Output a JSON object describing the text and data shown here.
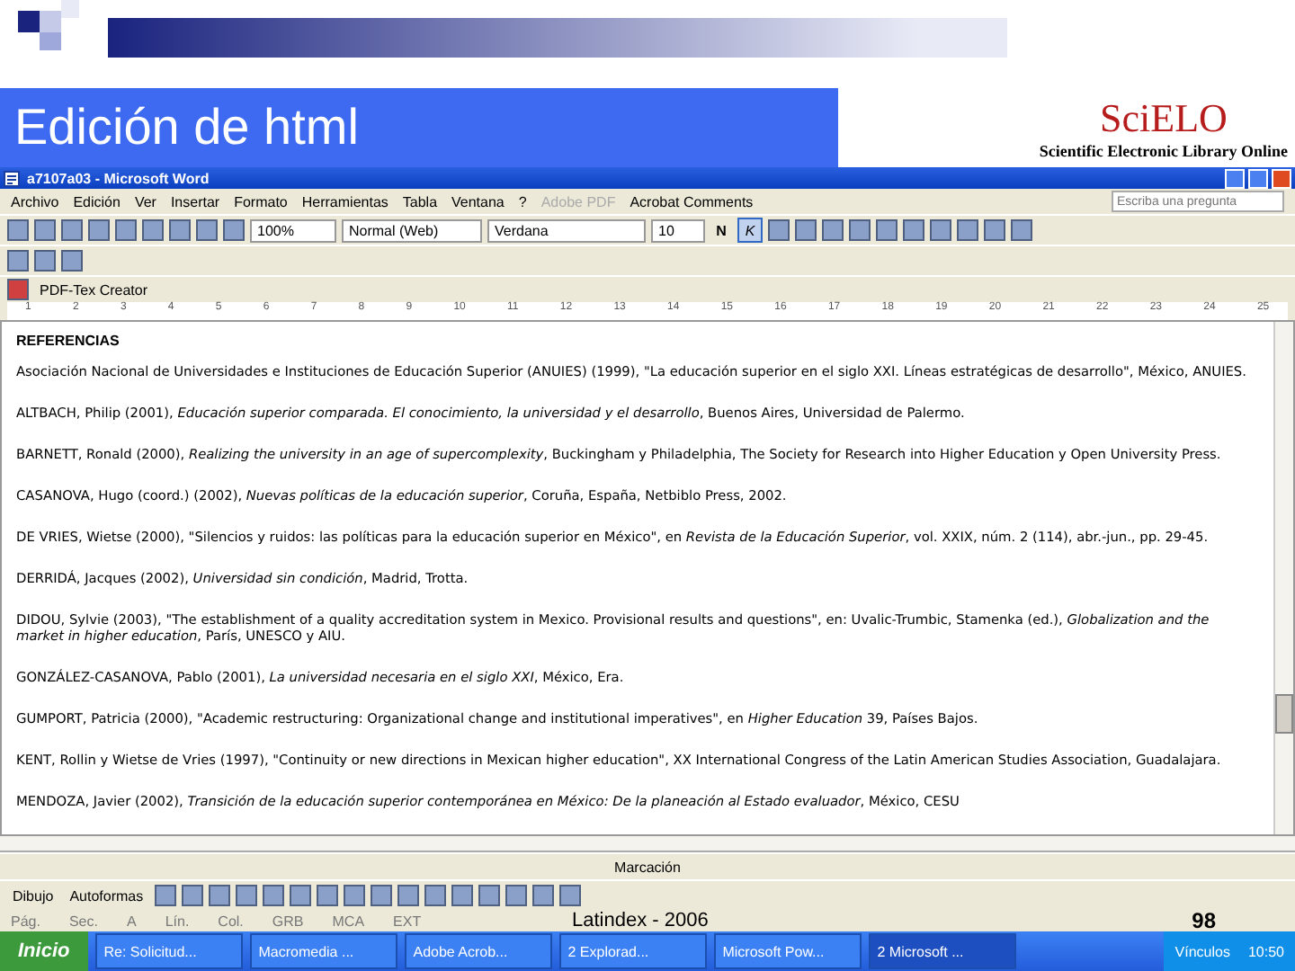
{
  "slide": {
    "title": "Edición de html",
    "logo": {
      "name": "SciELO",
      "tagline": "Scientific Electronic Library Online"
    },
    "footer": "Latindex - 2006",
    "page_number": "98"
  },
  "window": {
    "title": "a7107a03 - Microsoft Word"
  },
  "menu": [
    {
      "label": "Archivo",
      "disabled": false
    },
    {
      "label": "Edición",
      "disabled": false
    },
    {
      "label": "Ver",
      "disabled": false
    },
    {
      "label": "Insertar",
      "disabled": false
    },
    {
      "label": "Formato",
      "disabled": false
    },
    {
      "label": "Herramientas",
      "disabled": false
    },
    {
      "label": "Tabla",
      "disabled": false
    },
    {
      "label": "Ventana",
      "disabled": false
    },
    {
      "label": "?",
      "disabled": false
    },
    {
      "label": "Adobe PDF",
      "disabled": true
    },
    {
      "label": "Acrobat Comments",
      "disabled": false
    }
  ],
  "help_field": {
    "placeholder": "Escriba una pregunta"
  },
  "format_toolbar": {
    "zoom": "100%",
    "style": "Normal (Web)",
    "font": "Verdana",
    "size": "10",
    "bold": false,
    "italic": true,
    "bold_label": "N",
    "italic_label": "K"
  },
  "ruler": [
    "1",
    "2",
    "3",
    "4",
    "5",
    "6",
    "7",
    "8",
    "9",
    "10",
    "11",
    "12",
    "13",
    "14",
    "15",
    "16",
    "17",
    "18",
    "19",
    "20",
    "21",
    "22",
    "23",
    "24",
    "25"
  ],
  "pdf_toolbar": {
    "label": "PDF-Tex Creator"
  },
  "document": {
    "heading": "REFERENCIAS",
    "paragraphs": [
      "Asociación Nacional de Universidades e Instituciones de Educación Superior (ANUIES) (1999), \"La educación superior en el siglo XXI. Líneas estratégicas de desarrollo\", México, ANUIES.",
      "ALTBACH, Philip (2001), *Educación superior comparada. El conocimiento, la universidad y el desarrollo*, Buenos Aires, Universidad de Palermo.",
      "BARNETT, Ronald (2000), *Realizing the university in an age of supercomplexity*, Buckingham y Philadelphia, The Society for Research into Higher Education y Open University Press.",
      "CASANOVA, Hugo (coord.) (2002), *Nuevas políticas de la educación superior*, Coruña, España, Netbiblo Press, 2002.",
      "DE VRIES, Wietse (2000), \"Silencios y ruidos: las políticas para la educación superior en México\", en *Revista de la Educación Superior*, vol. XXIX, núm. 2 (114), abr.-jun., pp. 29-45.",
      "DERRIDÁ, Jacques (2002), *Universidad sin condición*, Madrid, Trotta.",
      "DIDOU, Sylvie (2003), \"The establishment of a quality accreditation system in Mexico. Provisional results and questions\", en: Uvalic-Trumbic, Stamenka (ed.), *Globalization and the market in higher education*, París, UNESCO y AIU.",
      "GONZÁLEZ-CASANOVA, Pablo (2001), *La universidad necesaria en el siglo XXI*, México, Era.",
      "GUMPORT, Patricia (2000), \"Academic restructuring: Organizational change and institutional imperatives\", en *Higher Education* 39, Países Bajos.",
      "KENT, Rollin y Wietse de Vries (1997), \"Continuity or new directions in Mexican higher education\", XX International Congress of the Latin American Studies Association, Guadalajara.",
      "MENDOZA, Javier (2002), *Transición de la educación superior contemporánea en México: De la planeación al Estado evaluador*, México, CESU"
    ]
  },
  "review_toolbar": {
    "label": "Marcación"
  },
  "drawing_toolbar": {
    "draw": "Dibujo",
    "autoshapes": "Autoformas"
  },
  "status_bar": [
    "Pág.",
    "Sec.",
    "A",
    "Lín.",
    "Col.",
    "GRB",
    "MCA",
    "EXT"
  ],
  "taskbar": {
    "start": "Inicio",
    "tasks": [
      {
        "label": "Re: Solicitud...",
        "selected": false
      },
      {
        "label": "Macromedia ...",
        "selected": false
      },
      {
        "label": "Adobe Acrob...",
        "selected": false
      },
      {
        "label": "2 Explorad...",
        "selected": false
      },
      {
        "label": "Microsoft Pow...",
        "selected": false
      },
      {
        "label": "2 Microsoft ...",
        "selected": true
      }
    ],
    "links": "Vínculos",
    "clock": "10:50"
  }
}
